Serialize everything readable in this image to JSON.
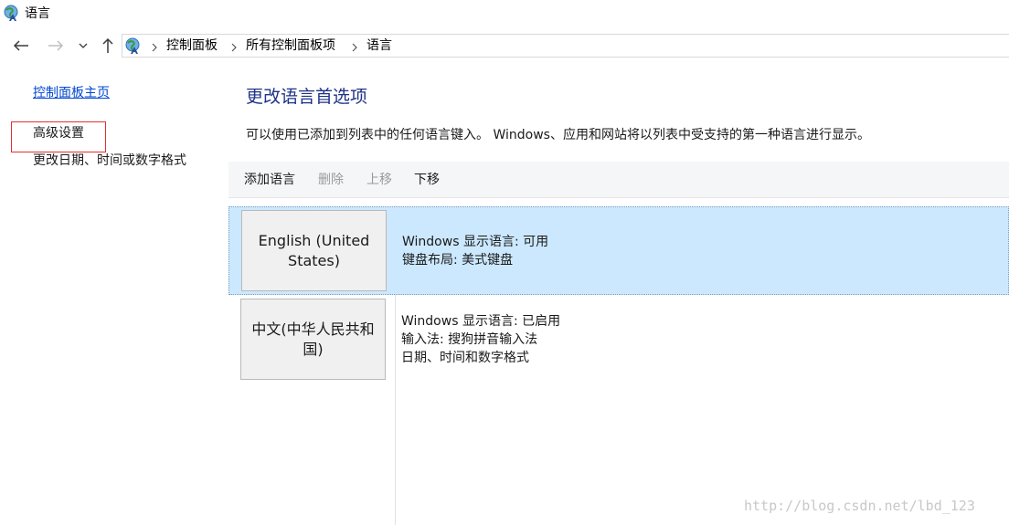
{
  "window": {
    "title": "语言",
    "icon": "language-globe-icon"
  },
  "navigation": {
    "back_icon": "arrow-left-icon",
    "forward_icon": "arrow-right-icon",
    "recent_icon": "chevron-down-icon",
    "up_icon": "arrow-up-icon",
    "breadcrumbs": [
      "控制面板",
      "所有控制面板项",
      "语言"
    ]
  },
  "sidebar": {
    "home_link": "控制面板主页",
    "advanced_link": "高级设置",
    "datetime_link": "更改日期、时间或数字格式",
    "annotation_color": "#e03030"
  },
  "main": {
    "title": "更改语言首选项",
    "description": "可以使用已添加到列表中的任何语言键入。 Windows、应用和网站将以列表中受支持的第一种语言进行显示。",
    "toolbar": {
      "add": "添加语言",
      "delete": "删除",
      "move_up": "上移",
      "move_down": "下移"
    },
    "languages": [
      {
        "name": "English (United States)",
        "selected": true,
        "details": [
          "Windows 显示语言: 可用",
          "键盘布局: 美式键盘"
        ]
      },
      {
        "name": "中文(中华人民共和国)",
        "selected": false,
        "details": [
          "Windows 显示语言: 已启用",
          "输入法: 搜狗拼音输入法",
          "日期、时间和数字格式"
        ]
      }
    ]
  },
  "watermark": "http://blog.csdn.net/lbd_123",
  "colors": {
    "link": "#0046d5",
    "title": "#1e3287",
    "selected_row": "#cce8ff"
  }
}
